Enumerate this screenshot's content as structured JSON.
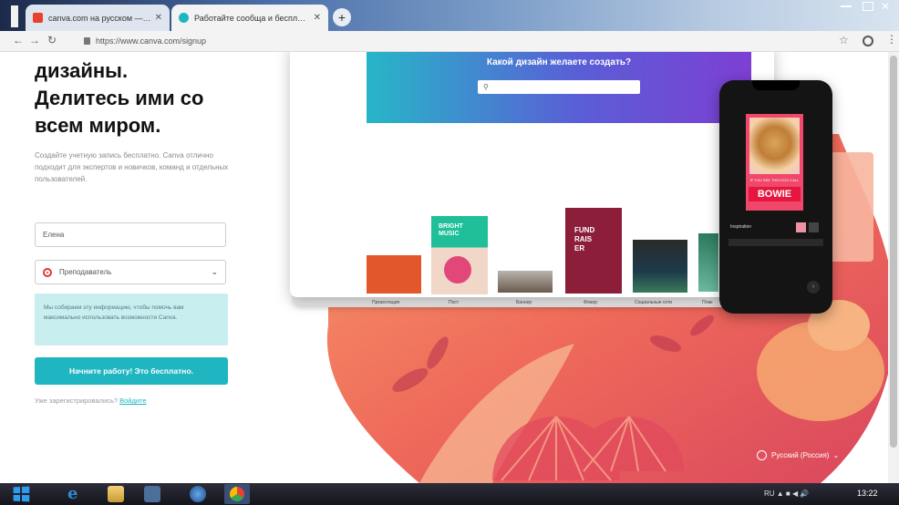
{
  "browser": {
    "tabs": [
      {
        "title": "canva.com на русском — Яндекс",
        "favicon_color": "#e8412c",
        "active": false
      },
      {
        "title": "Работайте сообща и бесплатно с Canva",
        "favicon_color": "#1fb6c1",
        "active": true
      }
    ],
    "new_tab_label": "+",
    "url": "https://www.canva.com/signup"
  },
  "signup": {
    "headline": [
      "дизайны.",
      "Делитесь ими со",
      "всем миром."
    ],
    "subtext": "Создайте учетную запись бесплатно. Canva отлично подходит для экспертов и новичков, команд и отдельных пользователей.",
    "name_value": "Елена",
    "role_value": "Преподаватель",
    "info_text": "Мы собираем эту информацию, чтобы помочь вам максимально использовать возможности Canva.",
    "cta_label": "Начните работу! Это бесплатно.",
    "login_prompt": "Уже зарегистрировались?",
    "login_link": "Войдите"
  },
  "canva_preview": {
    "hero_title": "Какой дизайн желаете создать?",
    "search_placeholder": "⚲",
    "templates": [
      {
        "label": "Презентация",
        "text": "",
        "color": "#e2572c"
      },
      {
        "label": "Пост",
        "text": "BRIGHT MUSIC",
        "color": "#e2477a"
      },
      {
        "label": "Баннер",
        "text": "",
        "color": "#6a5a4c"
      },
      {
        "label": "Флаер",
        "text": "FUND RAIS ER",
        "color": "#8c1e3a"
      },
      {
        "label": "Социальные сети",
        "text": "",
        "color": "#1c3a4a"
      },
      {
        "label": "Плак",
        "text": "",
        "color": "#2a7a5c"
      }
    ]
  },
  "phone_preview": {
    "card_top_text": "IF YOU SEE THIS DOG CALL",
    "card_title": "BOWIE",
    "label": "Inspiration"
  },
  "footer": {
    "language": "Русский (Россия)"
  },
  "taskbar": {
    "tray": "RU ▲ ■ ◀ 🔊",
    "clock": "13:22"
  }
}
